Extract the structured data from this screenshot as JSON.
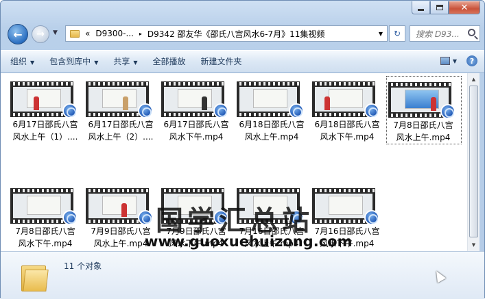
{
  "window": {
    "close_label": "✕"
  },
  "nav": {
    "back_glyph": "←",
    "forward_glyph": "→",
    "address_parts": [
      "«",
      "D9300-...",
      "▸",
      "D9342 邵友华《邵氏八宫风水6-7月》11集视频"
    ],
    "refresh_glyph": "↻",
    "search_placeholder": "搜索 D93..."
  },
  "toolbar": {
    "items": [
      "组织",
      "包含到库中",
      "共享",
      "全部播放",
      "新建文件夹"
    ],
    "help_glyph": "?"
  },
  "files": [
    {
      "line1": "6月17日邵氏八宫",
      "line2": "风水上午（1）...."
    },
    {
      "line1": "6月17日邵氏八宫",
      "line2": "风水上午（2）...."
    },
    {
      "line1": "6月17日邵氏八宫",
      "line2": "风水下午.mp4"
    },
    {
      "line1": "6月18日邵氏八宫",
      "line2": "风水上午.mp4"
    },
    {
      "line1": "6月18日邵氏八宫",
      "line2": "风水下午.mp4"
    },
    {
      "line1": "7月8日邵氏八宫",
      "line2": "风水上午.mp4"
    },
    {
      "line1": "7月8日邵氏八宫",
      "line2": "风水下午.mp4"
    },
    {
      "line1": "7月9日邵氏八宫",
      "line2": "风水上午.mp4"
    },
    {
      "line1": "7月9日邵氏八宫",
      "line2": "风水下午.mp4"
    },
    {
      "line1": "7月16日邵氏八宫",
      "line2": "风水上午.mp4"
    },
    {
      "line1": "7月16日邵氏八宫",
      "line2": "风水下午.mp4"
    }
  ],
  "watermark": {
    "title": "国学汇总站",
    "url": "www.guoxuehuizong.com"
  },
  "status": {
    "count": "11 个对象"
  }
}
